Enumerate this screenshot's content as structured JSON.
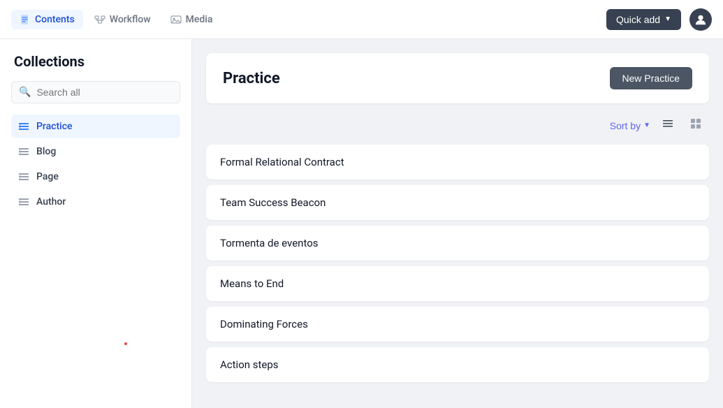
{
  "nav": {
    "tabs": [
      {
        "id": "contents",
        "label": "Contents",
        "icon": "doc-icon",
        "active": true
      },
      {
        "id": "workflow",
        "label": "Workflow",
        "icon": "workflow-icon",
        "active": false
      },
      {
        "id": "media",
        "label": "Media",
        "icon": "media-icon",
        "active": false
      }
    ],
    "quick_add_label": "Quick add",
    "avatar_icon": "user-icon"
  },
  "sidebar": {
    "title": "Collections",
    "search_placeholder": "Search all",
    "items": [
      {
        "id": "practice",
        "label": "Practice",
        "active": true
      },
      {
        "id": "blog",
        "label": "Blog",
        "active": false
      },
      {
        "id": "page",
        "label": "Page",
        "active": false
      },
      {
        "id": "author",
        "label": "Author",
        "active": false
      }
    ]
  },
  "content": {
    "title": "Practice",
    "new_button_label": "New Practice",
    "sort_by_label": "Sort by",
    "list_icon": "list-icon",
    "grid_icon": "grid-icon",
    "items": [
      {
        "id": 1,
        "title": "Formal Relational Contract"
      },
      {
        "id": 2,
        "title": "Team Success Beacon"
      },
      {
        "id": 3,
        "title": "Tormenta de eventos"
      },
      {
        "id": 4,
        "title": "Means to End"
      },
      {
        "id": 5,
        "title": "Dominating Forces"
      },
      {
        "id": 6,
        "title": "Action steps"
      }
    ]
  }
}
